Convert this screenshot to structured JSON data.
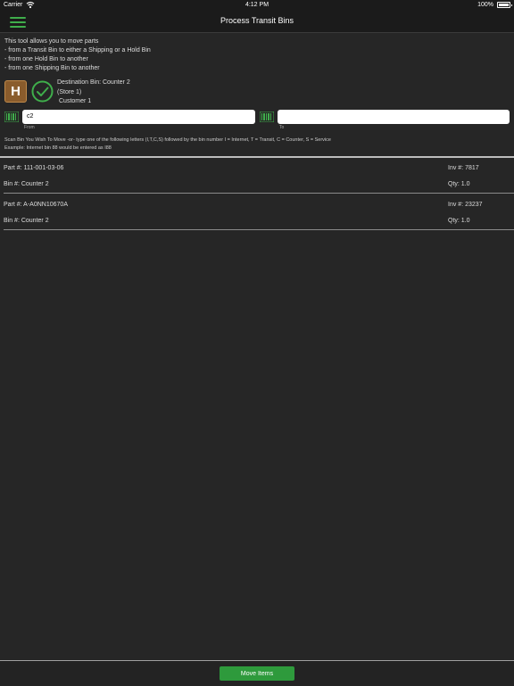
{
  "status_bar": {
    "carrier": "Carrier",
    "time": "4:12 PM",
    "battery": "100%"
  },
  "nav": {
    "title": "Process Transit Bins",
    "menu_icon": "hamburger-menu-icon"
  },
  "intro": {
    "line1": "This tool allows you to move parts",
    "line2": "- from a Transit Bin to either a Shipping or a Hold Bin",
    "line3": "- from one Hold Bin to another",
    "line4": "- from one Shipping Bin to another"
  },
  "bin_type_icon": {
    "letter": "H",
    "color": "#8a5c2c"
  },
  "status_icon": {
    "name": "check-circle-icon",
    "color": "#3fae4b"
  },
  "destination": {
    "bin": "Destination Bin: Counter 2",
    "store": "(Store 1)",
    "customer": "Customer 1"
  },
  "from_field": {
    "value": "c2",
    "label": "From"
  },
  "to_field": {
    "value": "",
    "label": "To"
  },
  "instructions": {
    "line1": "Scan Bin You Wish To Move -or- type one of the following letters (I,T,C,S) followed by the bin number I = Internet, T = Transit, C = Counter, S = Service",
    "line2": "Example: Internet bin 88 would be entered as I88"
  },
  "items": [
    {
      "part": "Part #: 111-001-03-06",
      "bin": "Bin #: Counter 2",
      "inv": "Inv #: 7817",
      "qty": "Qty: 1.0"
    },
    {
      "part": "Part #: A-A0NN10670A",
      "bin": "Bin #: Counter 2",
      "inv": "Inv #: 23237",
      "qty": "Qty: 1.0"
    }
  ],
  "footer": {
    "move_button": "Move Items"
  },
  "colors": {
    "accent": "#3fae4b",
    "button": "#2e9a3c",
    "background": "#262626"
  }
}
